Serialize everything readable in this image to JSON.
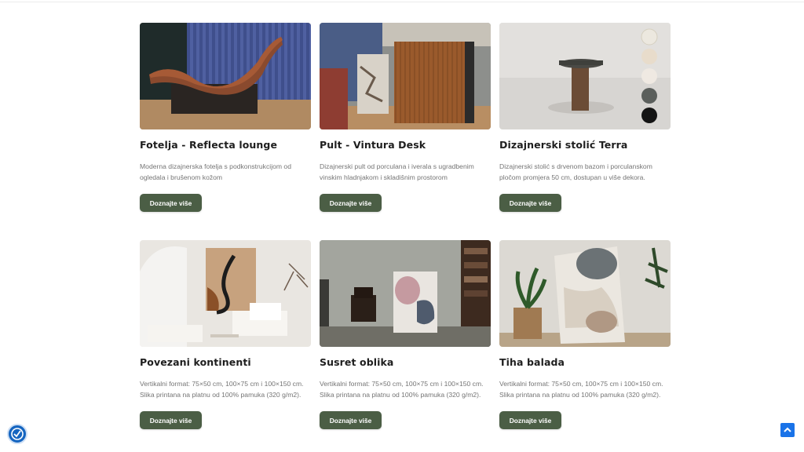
{
  "colors": {
    "button_bg": "#4b5e45",
    "button_text": "#ffffff",
    "accent_blue": "#1a73e8"
  },
  "products": [
    {
      "title": "Fotelja - Reflecta lounge",
      "description": "Moderna dizajnerska fotelja s podkonstrukcijom od ogledala i brušenom kožom",
      "button": "Doznajte više",
      "image_icon": "lounge-chair-image"
    },
    {
      "title": "Pult - Vintura Desk",
      "description": "Dizajnerski pult od porculana i iverala s ugradbenim vinskim hladnjakom i skladišnim prostorom",
      "button": "Doznajte više",
      "image_icon": "desk-image"
    },
    {
      "title": "Dizajnerski stolić Terra",
      "description": "Dizajnerski stolić s drvenom bazom i porculanskom pločom promjera 50 cm, dostupan u više dekora.",
      "button": "Doznajte više",
      "image_icon": "side-table-image"
    },
    {
      "title": "Povezani kontinenti",
      "description": "Vertikalni format: 75×50 cm, 100×75 cm i 100×150 cm. Slika printana na platnu od 100% pamuka (320 g/m2).",
      "button": "Doznajte više",
      "image_icon": "abstract-art-living-room-image"
    },
    {
      "title": "Susret oblika",
      "description": "Vertikalni format: 75×50 cm, 100×75 cm i 100×150 cm. Slika printana na platnu od 100% pamuka (320 g/m2).",
      "button": "Doznajte više",
      "image_icon": "abstract-art-study-image"
    },
    {
      "title": "Tiha balada",
      "description": "Vertikalni format: 75×50 cm, 100×75 cm i 100×150 cm. Slika printana na platnu od 100% pamuka (320 g/m2).",
      "button": "Doznajte više",
      "image_icon": "abstract-art-plant-image"
    }
  ],
  "widgets": {
    "accessibility_icon": "accessibility-icon",
    "scroll_top_icon": "scroll-to-top-icon"
  }
}
